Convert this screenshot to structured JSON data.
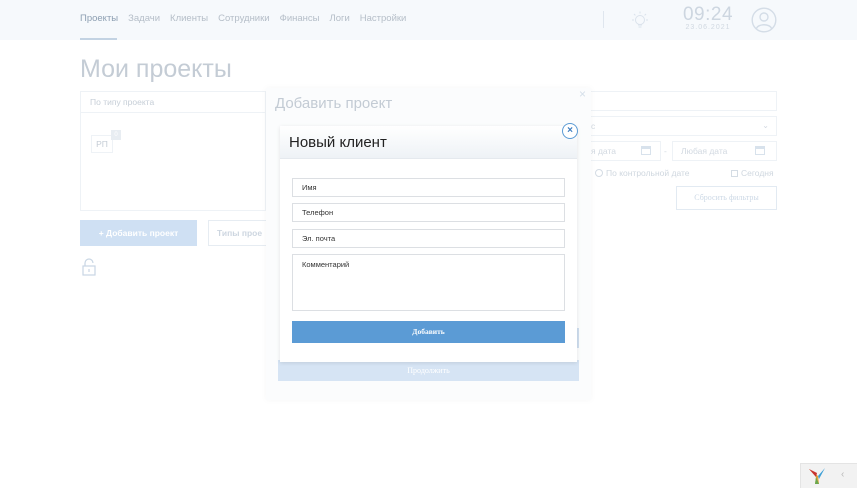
{
  "header": {
    "nav": [
      "Проекты",
      "Задачи",
      "Клиенты",
      "Сотрудники",
      "Финансы",
      "Логи",
      "Настройки"
    ],
    "clock_time": "09:24",
    "clock_date": "23.06.2021"
  },
  "page": {
    "title": "Мои проекты",
    "filter_label": "По типу проекта",
    "tag": "РП",
    "tag_badge": "0",
    "add_project": "+ Добавить проект",
    "project_types": "Типы прое"
  },
  "right_filters": {
    "select_fragment": "с",
    "date_from": "я дата",
    "dash": "-",
    "date_to": "Любая дата",
    "by_control_date": "По контрольной дате",
    "today": "Сегодня",
    "reset": "Сбросить фильтры"
  },
  "modal_project": {
    "title": "Добавить проект",
    "close": "×",
    "continue": "Продолжить"
  },
  "modal_client": {
    "title": "Новый клиент",
    "close": "×",
    "fields": {
      "name": "Имя",
      "phone": "Телефон",
      "email": "Эл. почта",
      "comment": "Комментарий"
    },
    "submit": "Добавить"
  },
  "debug": {
    "collapse": "‹"
  },
  "colors": {
    "accent": "#5b9bd5",
    "accent_faded": "#cfe0f3"
  }
}
